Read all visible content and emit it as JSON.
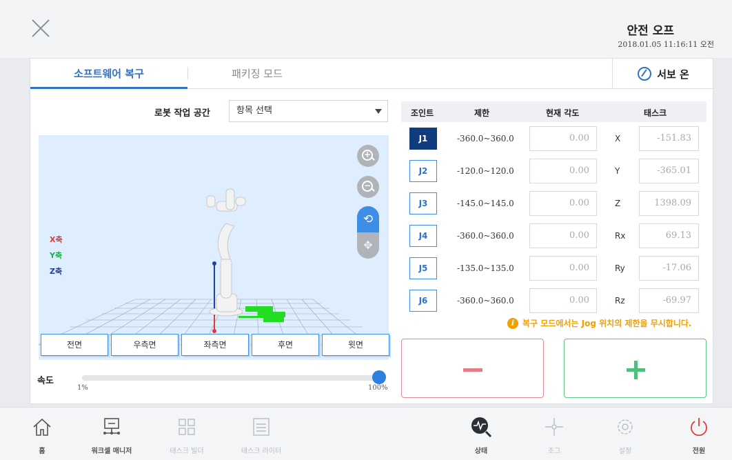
{
  "header": {
    "safety_status": "안전 오프",
    "datetime": "2018.01.05 11:16:11 오전"
  },
  "tabs": {
    "active": "소프트웨어 복구",
    "inactive": "패키징 모드",
    "servo_label": "서보 온"
  },
  "workspace": {
    "label": "로봇 작업 공간",
    "selected": "항목 선택"
  },
  "axes": {
    "x": "X축",
    "y": "Y축",
    "z": "Z축"
  },
  "colors": {
    "accent": "#2f72c9",
    "x_axis": "#e53935",
    "y_axis": "#2aa84a",
    "z_axis": "#1e3fa8",
    "warning": "#f0a000",
    "minus": "#e47c86",
    "plus": "#4fc07a",
    "power": "#e53935"
  },
  "view_buttons": [
    "전면",
    "우측면",
    "좌측면",
    "후면",
    "윗면"
  ],
  "speed": {
    "label": "속도",
    "min": "1%",
    "max": "100%",
    "value_percent": 100
  },
  "joint_table": {
    "headers": {
      "joint": "조인트",
      "limit": "제한",
      "angle": "현재 각도",
      "task": "태스크"
    },
    "rows": [
      {
        "joint": "J1",
        "limit": "-360.0~360.0",
        "angle": "0.00",
        "task_axis": "X",
        "task_value": "-151.83"
      },
      {
        "joint": "J2",
        "limit": "-120.0~120.0",
        "angle": "0.00",
        "task_axis": "Y",
        "task_value": "-365.01"
      },
      {
        "joint": "J3",
        "limit": "-145.0~145.0",
        "angle": "0.00",
        "task_axis": "Z",
        "task_value": "1398.09"
      },
      {
        "joint": "J4",
        "limit": "-360.0~360.0",
        "angle": "0.00",
        "task_axis": "Rx",
        "task_value": "69.13"
      },
      {
        "joint": "J5",
        "limit": "-135.0~135.0",
        "angle": "0.00",
        "task_axis": "Ry",
        "task_value": "-17.06"
      },
      {
        "joint": "J6",
        "limit": "-360.0~360.0",
        "angle": "0.00",
        "task_axis": "Rz",
        "task_value": "-69.97"
      }
    ],
    "selected_joint": "J1"
  },
  "notice": "복구 모드에서는 Jog 위치의 제한을 무시합니다.",
  "bottom_nav": [
    {
      "label": "홈",
      "icon": "home-icon"
    },
    {
      "label": "워크셀 매니저",
      "icon": "workcell-icon"
    },
    {
      "label": "태스크 빌더",
      "icon": "task-builder-icon"
    },
    {
      "label": "태스크 라이터",
      "icon": "task-writer-icon"
    },
    {
      "label": "상태",
      "icon": "status-icon"
    },
    {
      "label": "조그",
      "icon": "jog-icon"
    },
    {
      "label": "설정",
      "icon": "settings-icon"
    },
    {
      "label": "전원",
      "icon": "power-icon"
    }
  ]
}
